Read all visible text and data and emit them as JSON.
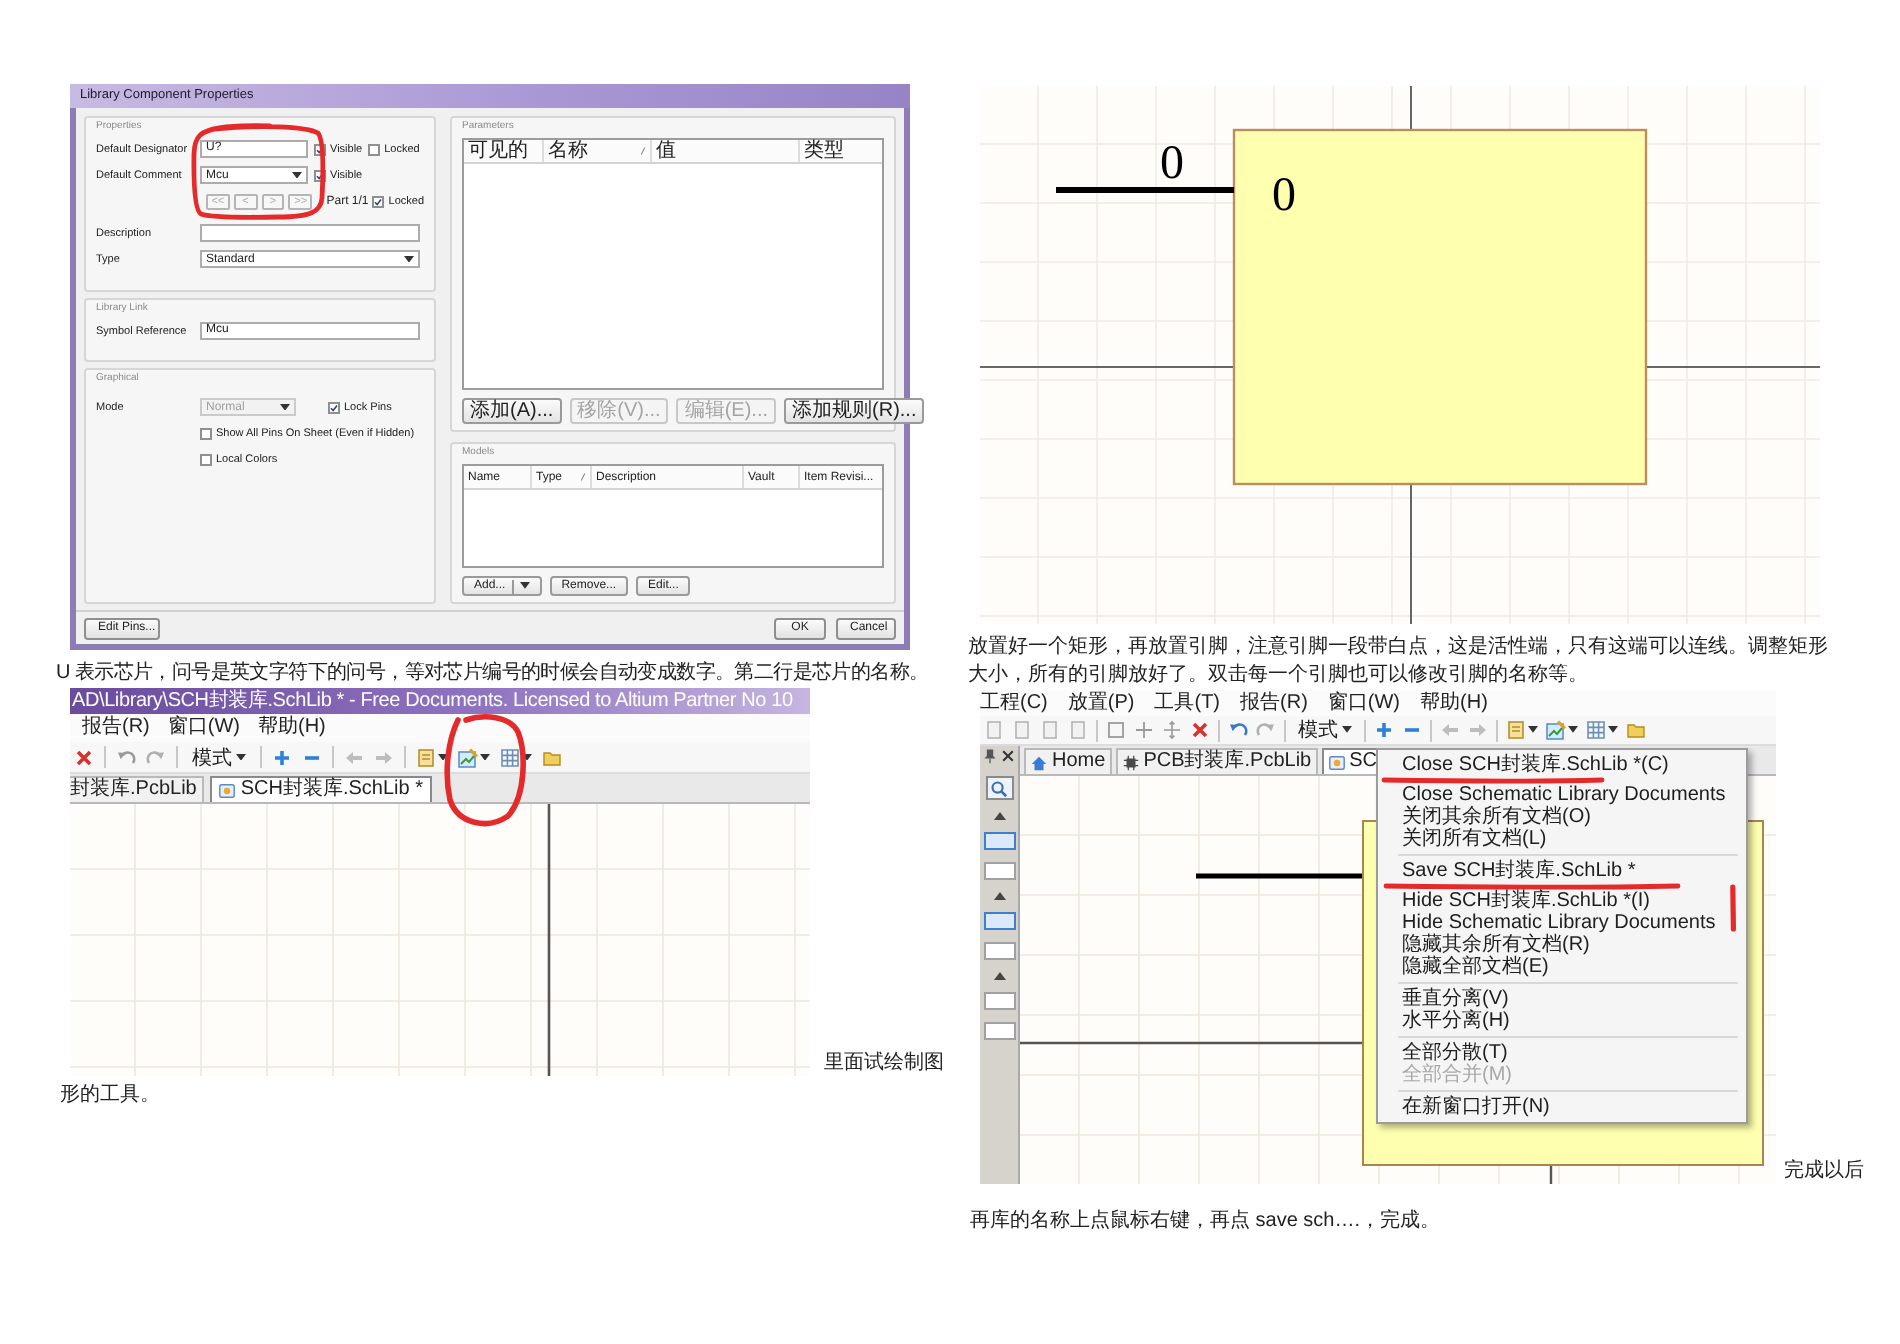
{
  "dialog": {
    "title": "Library Component Properties",
    "properties": {
      "label": "Properties",
      "designator": {
        "label": "Default Designator",
        "value": "U?",
        "visible": {
          "label": "Visible",
          "checked": true
        },
        "locked": {
          "label": "Locked",
          "checked": false
        }
      },
      "comment": {
        "label": "Default Comment",
        "value": "Mcu",
        "visible": {
          "label": "Visible",
          "checked": true
        }
      },
      "part_buttons": [
        {
          "label": "<<",
          "disabled": true
        },
        {
          "label": "<",
          "disabled": true
        },
        {
          "label": ">",
          "disabled": true
        },
        {
          "label": ">>",
          "disabled": true
        }
      ],
      "part": "Part 1/1",
      "part_locked": {
        "label": "Locked",
        "checked": true
      },
      "description": {
        "label": "Description"
      },
      "type": {
        "label": "Type",
        "value": "Standard"
      }
    },
    "library_link": {
      "label": "Library Link",
      "symbol_reference": {
        "label": "Symbol Reference",
        "value": "Mcu"
      }
    },
    "graphical": {
      "label": "Graphical",
      "mode": {
        "label": "Mode",
        "value": "Normal",
        "disabled": true
      },
      "lock_pins": {
        "label": "Lock Pins",
        "checked": true
      },
      "options": [
        {
          "label": "Show All Pins On Sheet (Even if Hidden)",
          "checked": false
        },
        {
          "label": "Local Colors",
          "checked": false
        }
      ]
    },
    "parameters": {
      "label": "Parameters",
      "columns": [
        {
          "label": "可见的",
          "sorted": false
        },
        {
          "label": "名称",
          "sorted": true
        },
        {
          "label": "值",
          "sorted": false
        },
        {
          "label": "类型",
          "sorted": false
        }
      ],
      "buttons": [
        {
          "label": "添加(A)...",
          "disabled": false
        },
        {
          "label": "移除(V)...",
          "disabled": true
        },
        {
          "label": "编辑(E)...",
          "disabled": true
        },
        {
          "label": "添加规则(R)...",
          "disabled": false
        }
      ]
    },
    "models": {
      "label": "Models",
      "columns": [
        {
          "label": "Name",
          "sorted": false
        },
        {
          "label": "Type",
          "sorted": true
        },
        {
          "label": "Description",
          "sorted": false
        },
        {
          "label": "Vault",
          "sorted": false
        },
        {
          "label": "Item Revisi...",
          "sorted": false
        }
      ],
      "buttons": [
        {
          "label": "Add...",
          "disabled": false,
          "dropdown": true
        },
        {
          "label": "Remove...",
          "disabled": false,
          "dropdown": false
        },
        {
          "label": "Edit...",
          "disabled": false,
          "dropdown": false
        }
      ]
    },
    "buttons": {
      "edit_pins": "Edit Pins...",
      "ok": "OK",
      "cancel": "Cancel"
    }
  },
  "caption_1": "U 表示芯片，问号是英文字符下的问号，等对芯片编号的时候会自动变成数字。第二行是芯片的名称。",
  "editor_window": {
    "title": "AD\\Library\\SCH封装库.SchLib * - Free Documents. Licensed to Altium Partner No 10",
    "menu": [
      "报告(R)",
      "窗口(W)",
      "帮助(H)"
    ],
    "toolbar_mode": "模式",
    "tabs": [
      {
        "label": "封装库.PcbLib",
        "kind": "plain",
        "selected": false
      },
      {
        "label": "SCH封装库.SchLib *",
        "kind": "schematic",
        "selected": true
      }
    ]
  },
  "paragraph_2": [
    "里面试绘制图",
    "形的工具。"
  ],
  "schematic": {
    "pin_designator": "0",
    "pin_name": "0"
  },
  "caption_3": "放置好一个矩形，再放置引脚，注意引脚一段带白点，这是活性端，只有这端可以连线。调整矩形大小，所有的引脚放好了。双击每一个引脚也可以修改引脚的名称等。",
  "editor_window_2": {
    "menu": [
      "工程(C)",
      "放置(P)",
      "工具(T)",
      "报告(R)",
      "窗口(W)",
      "帮助(H)"
    ],
    "toolbar_mode": "模式",
    "tabs": [
      {
        "label": "Home",
        "kind": "home",
        "selected": false
      },
      {
        "label": "PCB封装库.PcbLib",
        "kind": "pcb",
        "selected": false
      },
      {
        "label": "SC",
        "kind": "schematic",
        "selected": true
      }
    ],
    "context_menu": [
      {
        "items": [
          {
            "label": "Close SCH封装库.SchLib *(C)",
            "disabled": false
          },
          {
            "label": "Close Schematic Library Documents",
            "disabled": false
          },
          {
            "label": "关闭其余所有文档(O)",
            "disabled": false
          },
          {
            "label": "关闭所有文档(L)",
            "disabled": false
          }
        ]
      },
      {
        "items": [
          {
            "label": "Save SCH封装库.SchLib *",
            "disabled": false
          },
          {
            "label": "Hide SCH封装库.SchLib *(I)",
            "disabled": false
          },
          {
            "label": "Hide Schematic Library Documents",
            "disabled": false
          },
          {
            "label": "隐藏其余所有文档(R)",
            "disabled": false
          },
          {
            "label": "隐藏全部文档(E)",
            "disabled": false
          }
        ]
      },
      {
        "items": [
          {
            "label": "垂直分离(V)",
            "disabled": false
          },
          {
            "label": "水平分离(H)",
            "disabled": false
          }
        ]
      },
      {
        "items": [
          {
            "label": "全部分散(T)",
            "disabled": false
          },
          {
            "label": "全部合并(M)",
            "disabled": true
          }
        ]
      },
      {
        "items": [
          {
            "label": "在新窗口打开(N)",
            "disabled": false
          }
        ]
      }
    ]
  },
  "paragraph_4": [
    "完成以后",
    "再库的名称上点鼠标右键，再点 save sch….，完成。"
  ]
}
